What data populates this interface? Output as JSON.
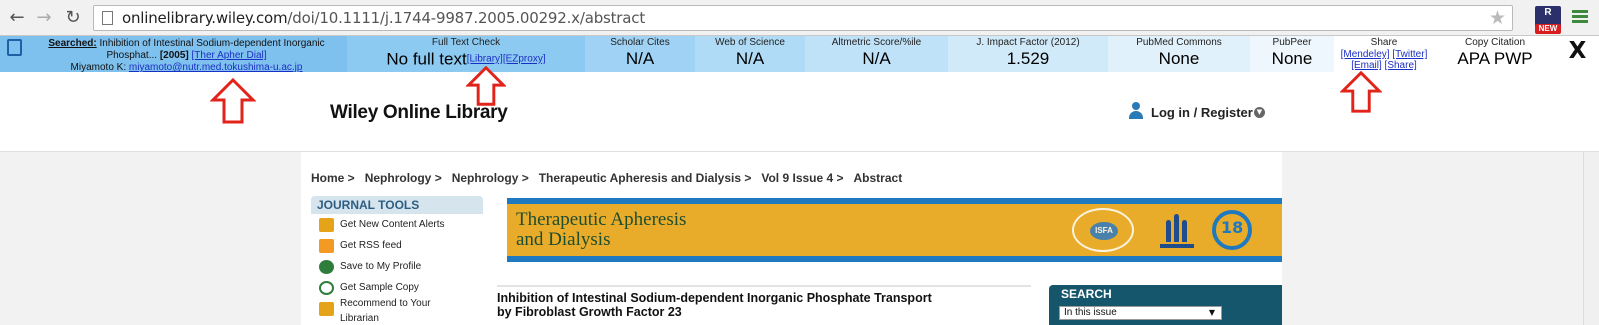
{
  "browser": {
    "back_glyph": "←",
    "forward_glyph": "→",
    "reload_glyph": "↻",
    "url_host": "onlinelibrary.wiley.com",
    "url_path": "/doi/10.1111/j.1744-9987.2005.00292.x/abstract",
    "star_glyph": "★",
    "extension_badge": "NEW",
    "extension_letters": "R"
  },
  "ext_bar": {
    "searched_label": "Searched:",
    "searched_text": "Inhibition of Intestinal Sodium-dependent Inorganic Phosphat...",
    "year": "[2005]",
    "journal_link": "[Ther Apher Dial]",
    "author_prefix": "Miyamoto K:",
    "author_email": "miyamoto@nutr.med.tokushima-u.ac.jp",
    "full_text_label": "Full Text Check",
    "full_text_value": "No full text",
    "library_link": "[Library]",
    "ezproxy_link": "[EZproxy]",
    "scholar_label": "Scholar Cites",
    "scholar_value": "N/A",
    "wos_label": "Web of Science",
    "wos_value": "N/A",
    "altmetric_label": "Altmetric Score/%ile",
    "altmetric_value": "N/A",
    "jif_label": "J. Impact Factor (2012)",
    "jif_value": "1.529",
    "pmc_label": "PubMed Commons",
    "pmc_value": "None",
    "pubpeer_label": "PubPeer",
    "pubpeer_value": "None",
    "share_label": "Share",
    "mendeley_link": "[Mendeley]",
    "twitter_link": "[Twitter]",
    "email_link": "[Email]",
    "share_link": "[Share]",
    "cite_label": "Copy Citation",
    "cite_value": "APA PWP",
    "close_label": "X"
  },
  "header": {
    "logo": "Wiley Online Library",
    "login": "Log in / Register",
    "login_caret": "▼"
  },
  "breadcrumb": [
    "Home >",
    "Nephrology >",
    "Nephrology >",
    "Therapeutic Apheresis and Dialysis >",
    "Vol 9 Issue 4 >",
    "Abstract"
  ],
  "journal_tools": {
    "heading": "JOURNAL TOOLS",
    "items": [
      {
        "label": "Get New Content Alerts",
        "icon": "alert-icon"
      },
      {
        "label": "Get RSS feed",
        "icon": "rss-icon"
      },
      {
        "label": "Save to My Profile",
        "icon": "save-icon"
      },
      {
        "label": "Get Sample Copy",
        "icon": "sample-icon"
      },
      {
        "label": "Recommend to Your",
        "label2": "Librarian",
        "icon": "recommend-icon"
      }
    ]
  },
  "banner": {
    "title_line1": "Therapeutic Apheresis",
    "title_line2": "and Dialysis",
    "isfa": "ISFA",
    "ring_num": "18"
  },
  "article": {
    "title_line1": "Inhibition of Intestinal Sodium-dependent Inorganic Phosphate Transport",
    "title_line2": "by Fibroblast Growth Factor 23"
  },
  "search": {
    "heading": "SEARCH",
    "scope": "In this issue",
    "caret": "▼"
  },
  "colors": {
    "annotation_arrow": "#e2231a",
    "banner_gold": "#e8ac2a",
    "banner_blue": "#1e79c0",
    "search_teal": "#16566c"
  }
}
